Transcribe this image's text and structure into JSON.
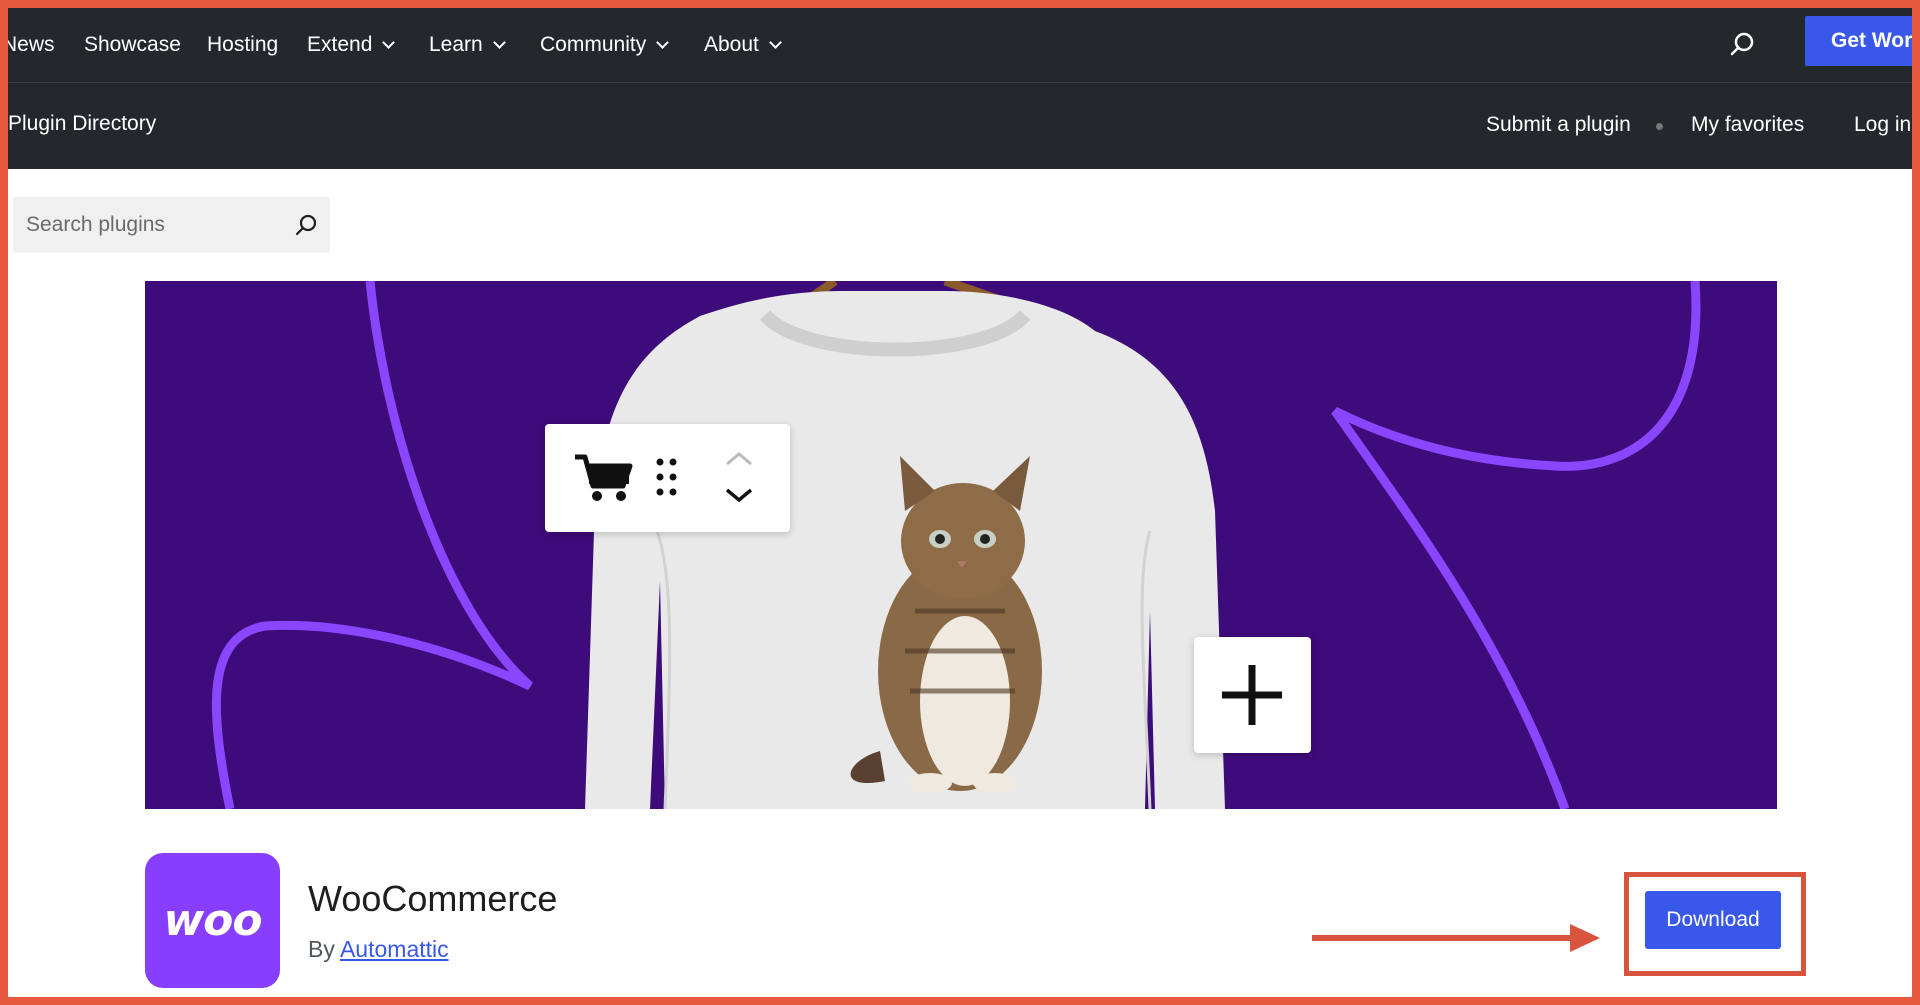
{
  "topnav": {
    "items": [
      {
        "label": "News",
        "has_dropdown": false
      },
      {
        "label": "Showcase",
        "has_dropdown": false
      },
      {
        "label": "Hosting",
        "has_dropdown": false
      },
      {
        "label": "Extend",
        "has_dropdown": true
      },
      {
        "label": "Learn",
        "has_dropdown": true
      },
      {
        "label": "Community",
        "has_dropdown": true
      },
      {
        "label": "About",
        "has_dropdown": true
      }
    ],
    "search_icon": "search-icon",
    "cta_label": "Get WordPress"
  },
  "subnav": {
    "title": "Plugin Directory",
    "links": [
      "Submit a plugin",
      "My favorites",
      "Log in"
    ]
  },
  "search": {
    "placeholder": "Search plugins",
    "icon": "search-icon"
  },
  "banner": {
    "toolbar_icons": [
      "cart-icon",
      "drag-handle-icon",
      "chevron-up-icon",
      "chevron-down-icon"
    ],
    "add_icon": "plus-icon"
  },
  "plugin": {
    "logo_text": "woo",
    "name": "WooCommerce",
    "by_prefix": "By",
    "author": "Automattic",
    "download_label": "Download"
  },
  "colors": {
    "nav_bg": "#23282d",
    "accent": "#3858e9",
    "banner_bg": "#3e0b7a",
    "woo_purple": "#873eff",
    "annotation": "#d9543d"
  }
}
